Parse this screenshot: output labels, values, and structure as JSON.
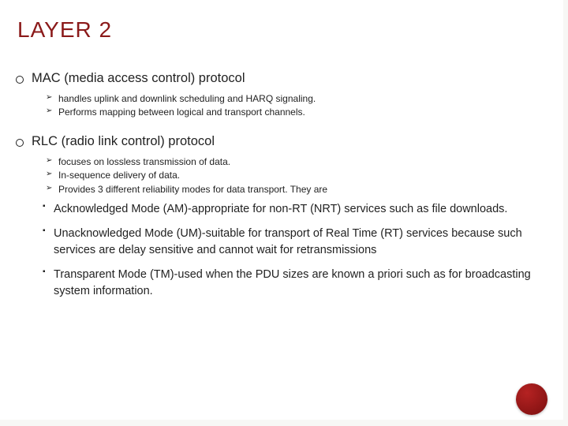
{
  "title": "LAYER 2",
  "sections": [
    {
      "heading": "MAC (media access control) protocol",
      "points": [
        "handles uplink and downlink scheduling and HARQ signaling.",
        "Performs mapping between logical and transport channels."
      ]
    },
    {
      "heading": "RLC (radio link control) protocol",
      "points": [
        "focuses on lossless transmission of data.",
        "In-sequence delivery of data.",
        "Provides 3 different reliability modes for data transport. They are"
      ],
      "modes": [
        "Acknowledged Mode (AM)-appropriate for non-RT (NRT) services such as file downloads.",
        "Unacknowledged Mode (UM)-suitable for transport of Real Time (RT) services because such services are delay sensitive and cannot wait for retransmissions",
        "Transparent Mode (TM)-used when the PDU sizes are known a priori such as for broadcasting system information."
      ]
    }
  ]
}
